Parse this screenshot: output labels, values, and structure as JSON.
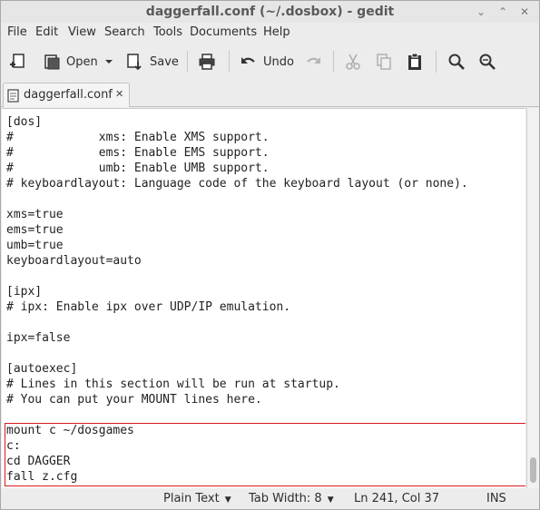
{
  "window": {
    "title": "daggerfall.conf (~/.dosbox) - gedit",
    "controls": {
      "minimize": "⌄",
      "maximize": "⌃",
      "close": "✕"
    }
  },
  "menubar": [
    "File",
    "Edit",
    "View",
    "Search",
    "Tools",
    "Documents",
    "Help"
  ],
  "toolbar": {
    "new_icon": "new-document-icon",
    "open_label": "Open",
    "save_label": "Save",
    "print_icon": "printer-icon",
    "undo_label": "Undo",
    "redo_icon": "redo-icon",
    "cut_icon": "cut-icon",
    "copy_icon": "copy-icon",
    "paste_icon": "paste-icon",
    "find_icon": "find-icon",
    "replace_icon": "find-replace-icon"
  },
  "tab": {
    "label": "daggerfall.conf",
    "close": "✕"
  },
  "editor": {
    "lines": [
      "[dos]",
      "#            xms: Enable XMS support.",
      "#            ems: Enable EMS support.",
      "#            umb: Enable UMB support.",
      "# keyboardlayout: Language code of the keyboard layout (or none).",
      "",
      "xms=true",
      "ems=true",
      "umb=true",
      "keyboardlayout=auto",
      "",
      "[ipx]",
      "# ipx: Enable ipx over UDP/IP emulation.",
      "",
      "ipx=false",
      "",
      "[autoexec]",
      "# Lines in this section will be run at startup.",
      "# You can put your MOUNT lines here.",
      "",
      "mount c ~/dosgames",
      "c:",
      "cd DAGGER",
      "fall z.cfg"
    ]
  },
  "statusbar": {
    "language": "Plain Text",
    "tab_width": "Tab Width:  8",
    "position": "Ln 241, Col 37",
    "mode": "INS"
  },
  "colors": {
    "highlight_border": "#d9191e"
  }
}
